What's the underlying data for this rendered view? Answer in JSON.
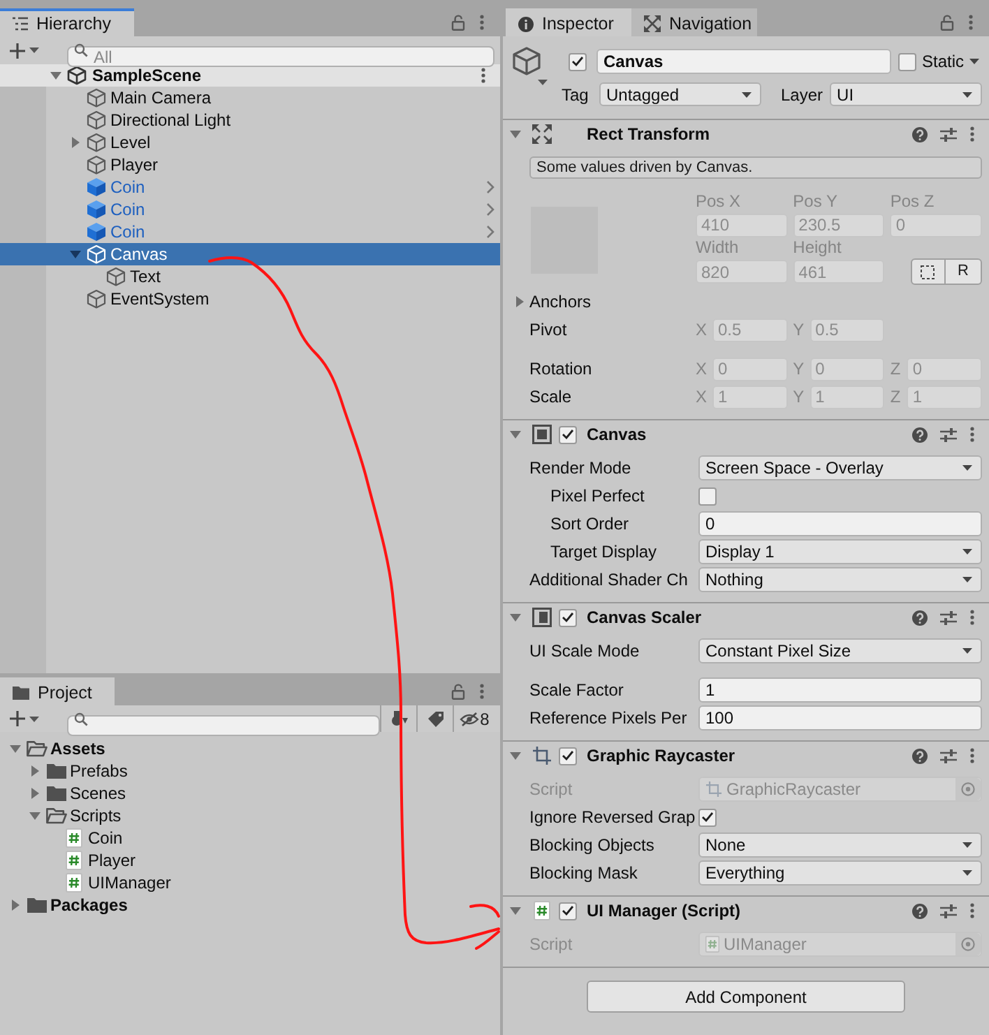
{
  "hierarchy": {
    "focused": true,
    "tabs": [
      {
        "label": "Hierarchy",
        "selected": true
      }
    ],
    "search": {
      "placeholder": "All"
    },
    "scene": {
      "name": "SampleScene",
      "expanded": true
    },
    "items": [
      {
        "name": "Main Camera",
        "kind": "object",
        "selected": false
      },
      {
        "name": "Directional Light",
        "kind": "object",
        "selected": false
      },
      {
        "name": "Level",
        "kind": "object",
        "selected": false,
        "expanded": false
      },
      {
        "name": "Player",
        "kind": "object",
        "selected": false
      },
      {
        "name": "Coin",
        "kind": "prefab",
        "selected": false
      },
      {
        "name": "Coin",
        "kind": "prefab",
        "selected": false
      },
      {
        "name": "Coin",
        "kind": "prefab",
        "selected": false
      },
      {
        "name": "Canvas",
        "kind": "object",
        "selected": true,
        "expanded": true,
        "children": [
          {
            "name": "Text",
            "kind": "object",
            "selected": false
          }
        ]
      },
      {
        "name": "EventSystem",
        "kind": "object",
        "selected": false
      }
    ]
  },
  "project": {
    "focused": false,
    "tabs": [
      {
        "label": "Project",
        "selected": true
      }
    ],
    "hidden_count": "8",
    "items": [
      {
        "name": "Assets",
        "kind": "folder",
        "expanded": true,
        "children": [
          {
            "name": "Prefabs",
            "kind": "folder",
            "expanded": false
          },
          {
            "name": "Scenes",
            "kind": "folder",
            "expanded": false
          },
          {
            "name": "Scripts",
            "kind": "folder",
            "expanded": true,
            "children": [
              {
                "name": "Coin",
                "kind": "script"
              },
              {
                "name": "Player",
                "kind": "script"
              },
              {
                "name": "UIManager",
                "kind": "script"
              }
            ]
          }
        ]
      },
      {
        "name": "Packages",
        "kind": "folder",
        "expanded": false
      }
    ]
  },
  "inspector": {
    "focused": false,
    "tabs": [
      {
        "label": "Inspector",
        "selected": true
      },
      {
        "label": "Navigation",
        "selected": false
      }
    ],
    "object": {
      "active": true,
      "name": "Canvas",
      "static": {
        "label": "Static",
        "checked": false
      },
      "tag": {
        "label": "Tag",
        "value": "Untagged"
      },
      "layer": {
        "label": "Layer",
        "value": "UI"
      }
    },
    "components": [
      {
        "kind": "rect_transform",
        "title": "Rect Transform",
        "expanded": true,
        "driven": true,
        "note": "Some values driven by Canvas.",
        "position": [
          {
            "label": "Pos X",
            "value": "410"
          },
          {
            "label": "Pos Y",
            "value": "230.5"
          },
          {
            "label": "Pos Z",
            "value": "0"
          }
        ],
        "size": [
          {
            "label": "Width",
            "value": "820"
          },
          {
            "label": "Height",
            "value": "461"
          }
        ],
        "raw_button": "R",
        "anchors": {
          "label": "Anchors",
          "expanded": false
        },
        "rows": [
          {
            "label": "Pivot",
            "axes": [
              {
                "axis": "X",
                "value": "0.5"
              },
              {
                "axis": "Y",
                "value": "0.5"
              }
            ]
          },
          {
            "label": "Rotation",
            "axes": [
              {
                "axis": "X",
                "value": "0"
              },
              {
                "axis": "Y",
                "value": "0"
              },
              {
                "axis": "Z",
                "value": "0"
              }
            ]
          },
          {
            "label": "Scale",
            "axes": [
              {
                "axis": "X",
                "value": "1"
              },
              {
                "axis": "Y",
                "value": "1"
              },
              {
                "axis": "Z",
                "value": "1"
              }
            ]
          }
        ]
      },
      {
        "kind": "canvas",
        "title": "Canvas",
        "enabled": true,
        "expanded": true,
        "properties": [
          {
            "label": "Render Mode",
            "kind": "dropdown",
            "value": "Screen Space - Overlay",
            "disabled": false,
            "children": [
              {
                "label": "Pixel Perfect",
                "kind": "checkbox",
                "checked": false,
                "disabled": false
              },
              {
                "label": "Sort Order",
                "kind": "field",
                "value": "0",
                "disabled": false
              },
              {
                "label": "Target Display",
                "kind": "dropdown",
                "value": "Display 1",
                "disabled": false
              }
            ]
          },
          {
            "label": "Additional Shader Ch",
            "kind": "dropdown",
            "value": "Nothing",
            "disabled": false
          }
        ]
      },
      {
        "kind": "canvas_scaler",
        "title": "Canvas Scaler",
        "enabled": true,
        "expanded": true,
        "properties": [
          {
            "label": "UI Scale Mode",
            "kind": "dropdown",
            "value": "Constant Pixel Size",
            "disabled": false
          },
          {
            "label": "Scale Factor",
            "kind": "field",
            "value": "1",
            "disabled": false
          },
          {
            "label": "Reference Pixels Per",
            "kind": "field",
            "value": "100",
            "disabled": false
          }
        ]
      },
      {
        "kind": "graphic_raycaster",
        "title": "Graphic Raycaster",
        "enabled": true,
        "expanded": true,
        "properties": [
          {
            "label": "Script",
            "kind": "object_field",
            "value": "GraphicRaycaster",
            "disabled": true
          },
          {
            "label": "Ignore Reversed Grap",
            "kind": "checkbox",
            "checked": true,
            "disabled": false
          },
          {
            "label": "Blocking Objects",
            "kind": "dropdown",
            "value": "None",
            "disabled": false
          },
          {
            "label": "Blocking Mask",
            "kind": "dropdown",
            "value": "Everything",
            "disabled": false
          }
        ]
      },
      {
        "kind": "script",
        "title": "UI Manager (Script)",
        "enabled": true,
        "expanded": true,
        "properties": [
          {
            "label": "Script",
            "kind": "object_field",
            "value": "UIManager",
            "disabled": true
          }
        ]
      }
    ],
    "add_button": "Add Component"
  }
}
